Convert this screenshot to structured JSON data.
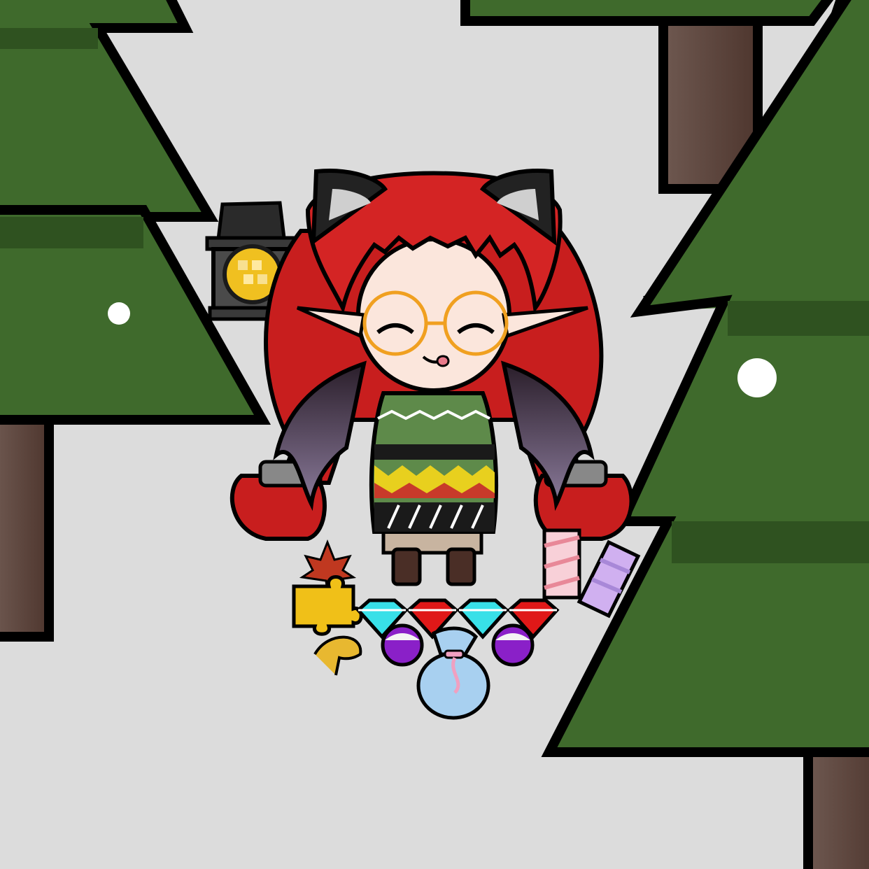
{
  "scene": {
    "kind": "dress-up character scene",
    "background": "snowy forest",
    "colors": {
      "snow": "#dcdcdc",
      "tree_dark": "#2f5220",
      "tree_mid": "#3f6a2c",
      "tree_light": "#4a7a35",
      "trunk": "#5a4038",
      "outline": "#000000"
    }
  },
  "character": {
    "hair_color": "#d42424",
    "ear_color": "#222222",
    "skin_color": "#fbe6dc",
    "glasses_color": "#f0a020",
    "wing_color": "#4a3a4a",
    "sweater_colors": [
      "#5e8a4a",
      "#e8d01e",
      "#c83a2a",
      "#1a1a1a"
    ],
    "expression": "happy-tongue-out"
  },
  "items": {
    "lantern": "lantern-icon",
    "maple_leaf": "maple-leaf-icon",
    "puzzle_piece": "puzzle-piece-icon",
    "ginkgo_leaf": "ginkgo-leaf-icon",
    "gems": [
      "cyan-gem-icon",
      "red-gem-icon",
      "cyan-gem-icon",
      "red-gem-icon"
    ],
    "potions": [
      "purple-orb-icon",
      "purple-orb-icon"
    ],
    "sack": "blue-sack-icon",
    "marshmallows": [
      "pink-marshmallow-icon",
      "lavender-marshmallow-icon"
    ]
  }
}
